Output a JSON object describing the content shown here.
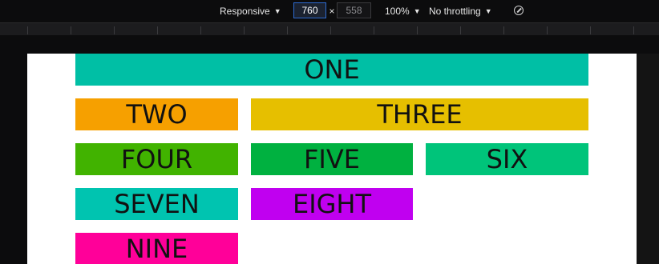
{
  "toolbar": {
    "device_label": "Responsive",
    "width_value": "760",
    "times_sign": "×",
    "height_placeholder": "558",
    "zoom_label": "100%",
    "throttle_label": "No throttling",
    "caret": "▼"
  },
  "boxes": [
    {
      "label": "ONE",
      "color": "#00bfa5"
    },
    {
      "label": "TWO",
      "color": "#f6a000"
    },
    {
      "label": "THREE",
      "color": "#e6bf00"
    },
    {
      "label": "FOUR",
      "color": "#41b300"
    },
    {
      "label": "FIVE",
      "color": "#00b140"
    },
    {
      "label": "SIX",
      "color": "#00c47a"
    },
    {
      "label": "SEVEN",
      "color": "#00c4b0"
    },
    {
      "label": "EIGHT",
      "color": "#c000f0"
    },
    {
      "label": "NINE",
      "color": "#ff0099"
    }
  ]
}
